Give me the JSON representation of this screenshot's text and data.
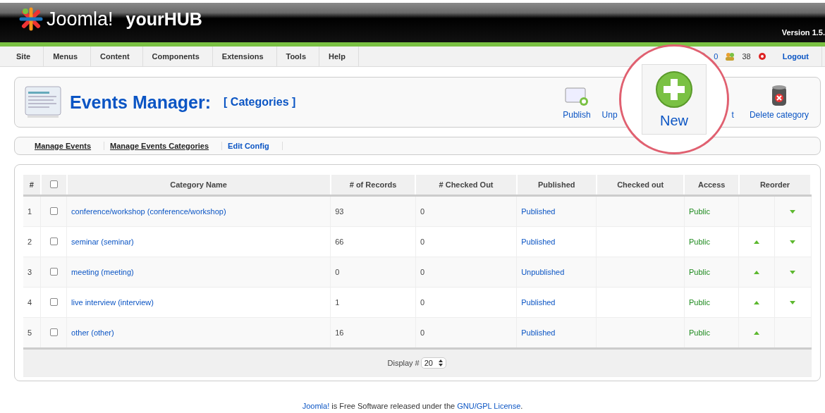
{
  "header": {
    "logo": "Joomla!",
    "site": "yourHUB",
    "version": "Version 1.5."
  },
  "menu": [
    "Site",
    "Menus",
    "Content",
    "Components",
    "Extensions",
    "Tools",
    "Help"
  ],
  "status": {
    "messages": "0",
    "users": "38",
    "logout": "Logout"
  },
  "page_title": {
    "title": "Events Manager:",
    "subtitle": "[ Categories ]"
  },
  "toolbar": [
    {
      "label": "Publish",
      "kind": "publish"
    },
    {
      "label": "Unp",
      "kind": "partial"
    },
    {
      "label": "t",
      "kind": "partial"
    },
    {
      "label": "Delete category",
      "kind": "delete"
    }
  ],
  "callout": {
    "label": "New"
  },
  "submenu": [
    {
      "label": "Manage Events",
      "selected": true
    },
    {
      "label": "Manage Events Categories",
      "selected": true
    },
    {
      "label": "Edit Config",
      "selected": false
    }
  ],
  "table": {
    "columns": [
      "#",
      "Category Name",
      "# of Records",
      "# Checked Out",
      "Published",
      "Checked out",
      "Access",
      "Reorder"
    ],
    "all_checked": false,
    "rows": [
      {
        "num": "1",
        "checked": false,
        "name": "conference/workshop (conference/workshop)",
        "records": "93",
        "checked_out": "0",
        "published": "Published",
        "access": "Public",
        "up": false,
        "down": true
      },
      {
        "num": "2",
        "checked": false,
        "name": "seminar (seminar)",
        "records": "66",
        "checked_out": "0",
        "published": "Published",
        "access": "Public",
        "up": true,
        "down": true
      },
      {
        "num": "3",
        "checked": false,
        "name": "meeting (meeting)",
        "records": "0",
        "checked_out": "0",
        "published": "Unpublished",
        "access": "Public",
        "up": true,
        "down": true
      },
      {
        "num": "4",
        "checked": false,
        "name": "live interview (interview)",
        "records": "1",
        "checked_out": "0",
        "published": "Published",
        "access": "Public",
        "up": true,
        "down": true
      },
      {
        "num": "5",
        "checked": false,
        "name": "other (other)",
        "records": "16",
        "checked_out": "0",
        "published": "Published",
        "access": "Public",
        "up": true,
        "down": false
      }
    ],
    "display_label": "Display #",
    "display_value": "20"
  },
  "footer": {
    "link1": "Joomla!",
    "text": "is Free Software released under the",
    "link2": "GNU/GPL License",
    "end": "."
  }
}
